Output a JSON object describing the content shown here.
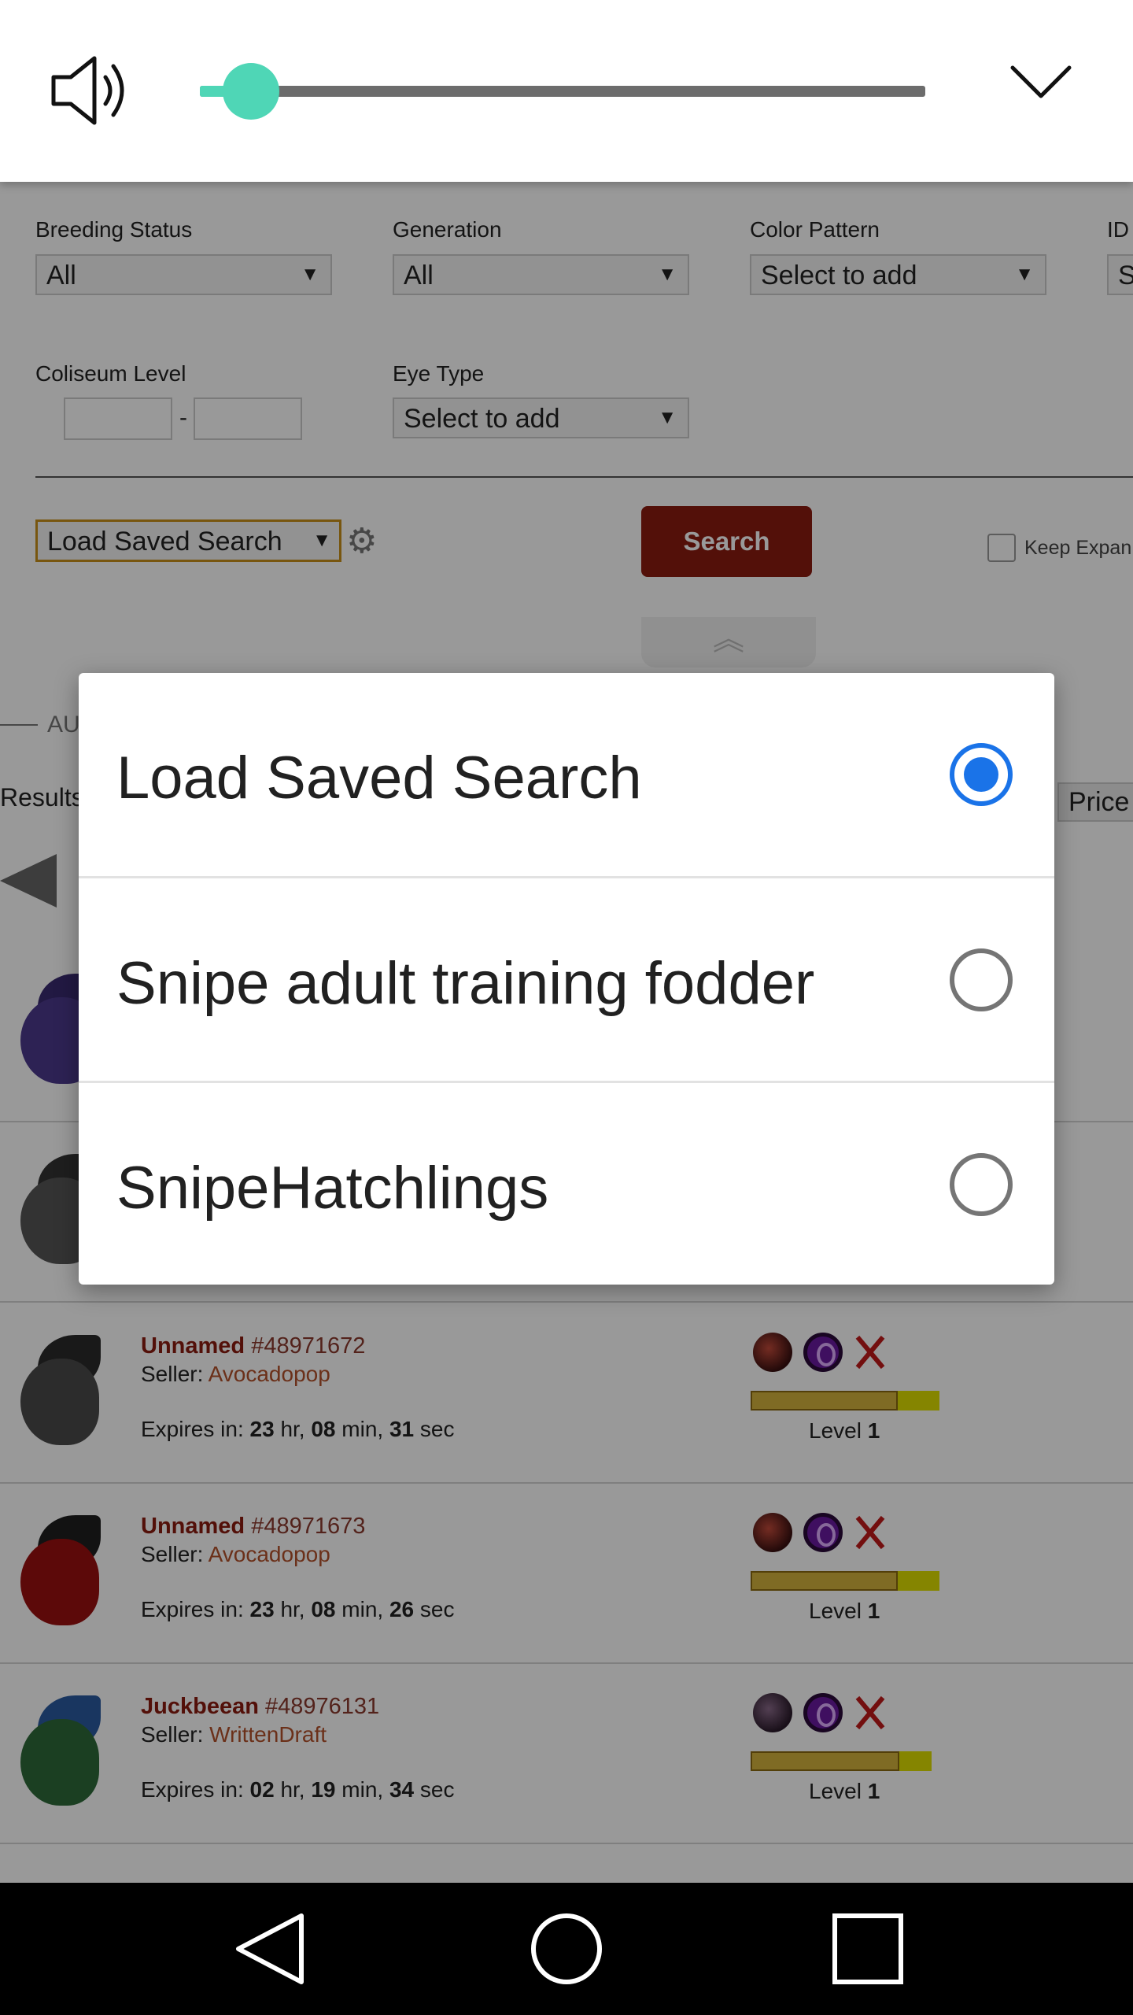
{
  "filters": {
    "breeding_status": {
      "label": "Breeding Status",
      "value": "All"
    },
    "generation": {
      "label": "Generation",
      "value": "All"
    },
    "color_pattern": {
      "label": "Color Pattern",
      "value": "Select to add"
    },
    "id": {
      "label": "ID",
      "value": "S"
    },
    "coliseum_level": {
      "label": "Coliseum Level",
      "separator": "-",
      "min": "",
      "max": ""
    },
    "eye_type": {
      "label": "Eye Type",
      "value": "Select to add"
    },
    "load_saved_search": "Load Saved Search",
    "search_button": "Search",
    "keep_expanded": "Keep Expan",
    "select_arrow": "▼",
    "collapse_glyph": "︽"
  },
  "results": {
    "section_label": "AU",
    "results_label": "Results",
    "sort_button": "Price",
    "listings": [
      {
        "name": "Unnamed",
        "id": "#48971672",
        "seller_label": "Seller:",
        "seller": "Avocadopop",
        "expires_label": "Expires in:",
        "hr": "23",
        "min": "08",
        "sec": "31",
        "level_label": "Level",
        "level": "1",
        "progress": 0.78
      },
      {
        "name": "Unnamed",
        "id": "#48971673",
        "seller_label": "Seller:",
        "seller": "Avocadopop",
        "expires_label": "Expires in:",
        "hr": "23",
        "min": "08",
        "sec": "26",
        "level_label": "Level",
        "level": "1",
        "progress": 0.78
      },
      {
        "name": "Juckbeean",
        "id": "#48976131",
        "seller_label": "Seller:",
        "seller": "WrittenDraft",
        "expires_label": "Expires in:",
        "hr": "02",
        "min": "19",
        "sec": "34",
        "level_label": "Level",
        "level": "1",
        "progress": 0.82
      }
    ],
    "time_units": {
      "hr": "hr,",
      "min": "min,",
      "sec": "sec"
    }
  },
  "volume_panel": {
    "level": 0.07,
    "accent_color": "#4fd6b6",
    "speaker_icon": "speaker-icon",
    "collapse_icon": "chevron-down-icon"
  },
  "dialog": {
    "options": [
      {
        "label": "Load Saved Search",
        "selected": true
      },
      {
        "label": "Snipe adult training fodder",
        "selected": false
      },
      {
        "label": "SnipeHatchlings",
        "selected": false
      }
    ],
    "accent_color": "#1a73e8"
  },
  "nav_bar": {
    "back_icon": "back-triangle-icon",
    "home_icon": "home-circle-icon",
    "recents_icon": "recents-square-icon"
  }
}
